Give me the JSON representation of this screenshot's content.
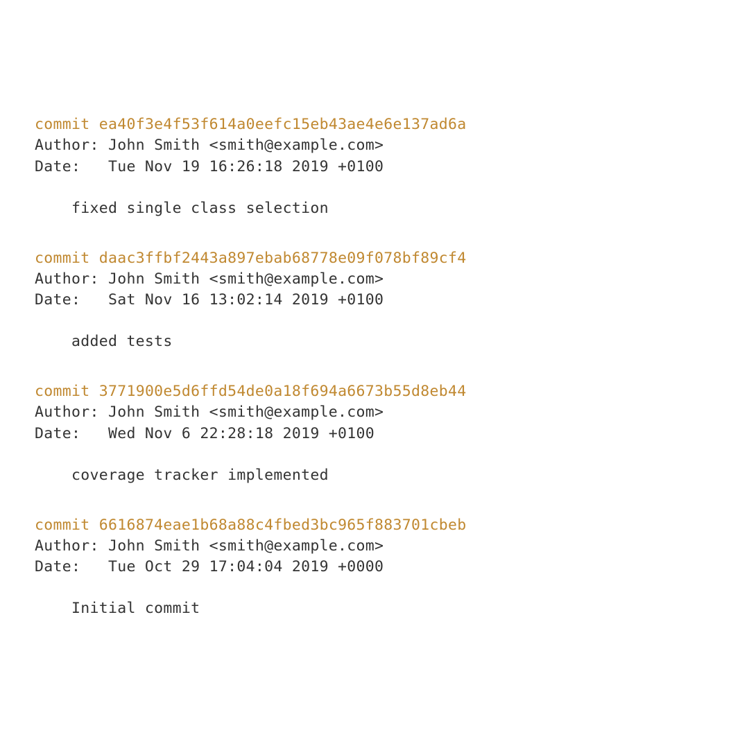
{
  "commits": [
    {
      "commit_prefix": "commit ",
      "hash": "ea40f3e4f53f614a0eefc15eb43ae4e6e137ad6a",
      "author_line": "Author: John Smith <smith@example.com>",
      "date_line": "Date:   Tue Nov 19 16:26:18 2019 +0100",
      "message": "    fixed single class selection"
    },
    {
      "commit_prefix": "commit ",
      "hash": "daac3ffbf2443a897ebab68778e09f078bf89cf4",
      "author_line": "Author: John Smith <smith@example.com>",
      "date_line": "Date:   Sat Nov 16 13:02:14 2019 +0100",
      "message": "    added tests"
    },
    {
      "commit_prefix": "commit ",
      "hash": "3771900e5d6ffd54de0a18f694a6673b55d8eb44",
      "author_line": "Author: John Smith <smith@example.com>",
      "date_line": "Date:   Wed Nov 6 22:28:18 2019 +0100",
      "message": "    coverage tracker implemented"
    },
    {
      "commit_prefix": "commit ",
      "hash": "6616874eae1b68a88c4fbed3bc965f883701cbeb",
      "author_line": "Author: John Smith <smith@example.com>",
      "date_line": "Date:   Tue Oct 29 17:04:04 2019 +0000",
      "message": "    Initial commit"
    }
  ]
}
